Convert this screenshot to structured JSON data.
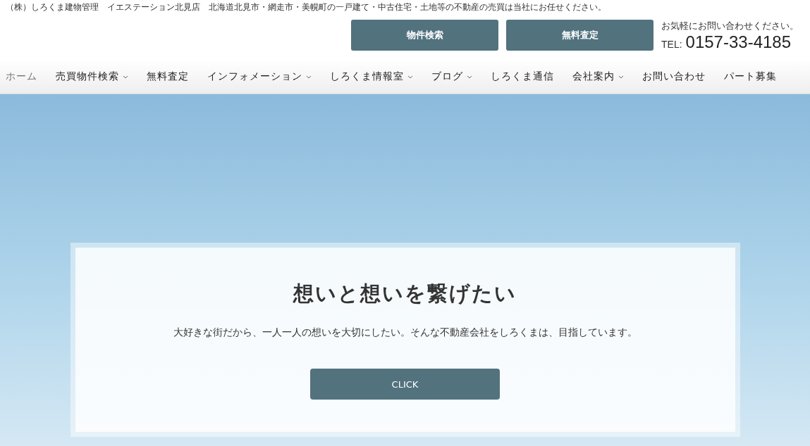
{
  "top_bar": {
    "text": "（株）しろくま建物管理　イエステーション北見店　北海道北見市・網走市・美幌町の一戸建て・中古住宅・土地等の不動産の売買は当社にお任せください。"
  },
  "header": {
    "buttons": [
      "物件検索",
      "無料査定"
    ],
    "contact": {
      "note": "お気軽にお問い合わせください。",
      "tel_label": "TEL:",
      "tel": "0157-33-4185"
    }
  },
  "nav": [
    {
      "label": "ホーム",
      "selected": true,
      "has_dropdown": false
    },
    {
      "label": "売買物件検索",
      "selected": false,
      "has_dropdown": true
    },
    {
      "label": "無料査定",
      "selected": false,
      "has_dropdown": false
    },
    {
      "label": "インフォメーション",
      "selected": false,
      "has_dropdown": true
    },
    {
      "label": "しろくま情報室",
      "selected": false,
      "has_dropdown": true
    },
    {
      "label": "ブログ",
      "selected": false,
      "has_dropdown": true
    },
    {
      "label": "しろくま通信",
      "selected": false,
      "has_dropdown": false
    },
    {
      "label": "会社案内",
      "selected": false,
      "has_dropdown": true
    },
    {
      "label": "お問い合わせ",
      "selected": false,
      "has_dropdown": false
    },
    {
      "label": "パート募集",
      "selected": false,
      "has_dropdown": false
    }
  ],
  "hero": {
    "title": "想いと想いを繋げたい",
    "text": "大好きな街だから、一人一人の想いを大切にしたい。そんな不動産会社をしろくまは、目指しています。",
    "button": "CLICK"
  }
}
